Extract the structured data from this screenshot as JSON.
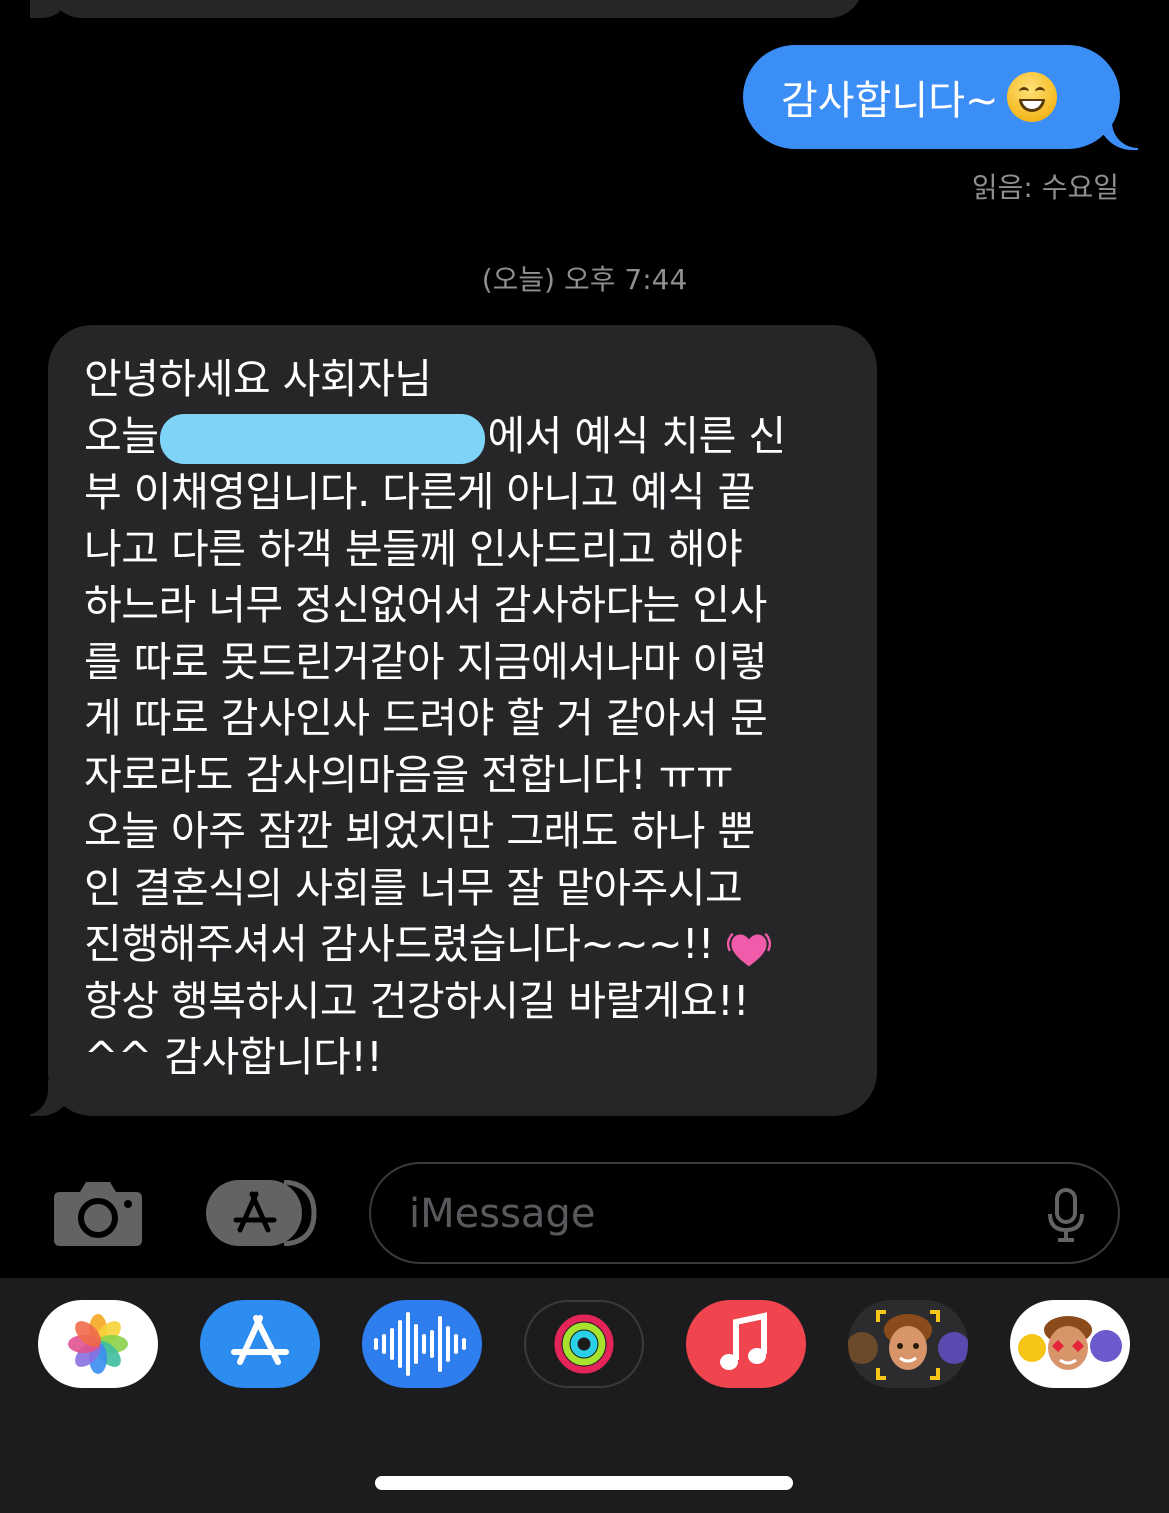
{
  "conversation": {
    "sent_message": {
      "text": "감사합니다~",
      "emoji": "grinning-face"
    },
    "read_receipt": "읽음: 수요일",
    "timestamp": "(오늘) 오후 7:44",
    "received_message": {
      "lines": [
        "안녕하세요 사회자님",
        "오늘",
        "에서 예식 치른 신",
        "부 이채영입니다. 다른게 아니고 예식 끝",
        "나고 다른 하객 분들께 인사드리고 해야",
        "하느라 너무 정신없어서 감사하다는 인사",
        "를 따로 못드린거같아 지금에서나마 이렇",
        "게 따로 감사인사 드려야 할 거 같아서 문",
        "자로라도 감사의마음을 전합니다! ㅠㅠ",
        "오늘 아주 잠깐 뵈었지만 그래도 하나 뿐",
        "인 결혼식의 사회를 너무 잘 맡아주시고",
        "진행해주셔서 감사드렸습니다~~~!!",
        "항상 행복하시고 건강하시길 바랄게요!!",
        "^^ 감사합니다!!"
      ],
      "emoji": "beating-heart"
    }
  },
  "compose": {
    "placeholder": "iMessage"
  },
  "app_drawer": {
    "apps": [
      "photos",
      "app-store",
      "audio-message",
      "fitness",
      "music",
      "memoji",
      "memoji-stickers"
    ]
  },
  "colors": {
    "sent_bubble": "#3c8ef7",
    "received_bubble": "#262629",
    "redaction": "#7fd3f7"
  }
}
